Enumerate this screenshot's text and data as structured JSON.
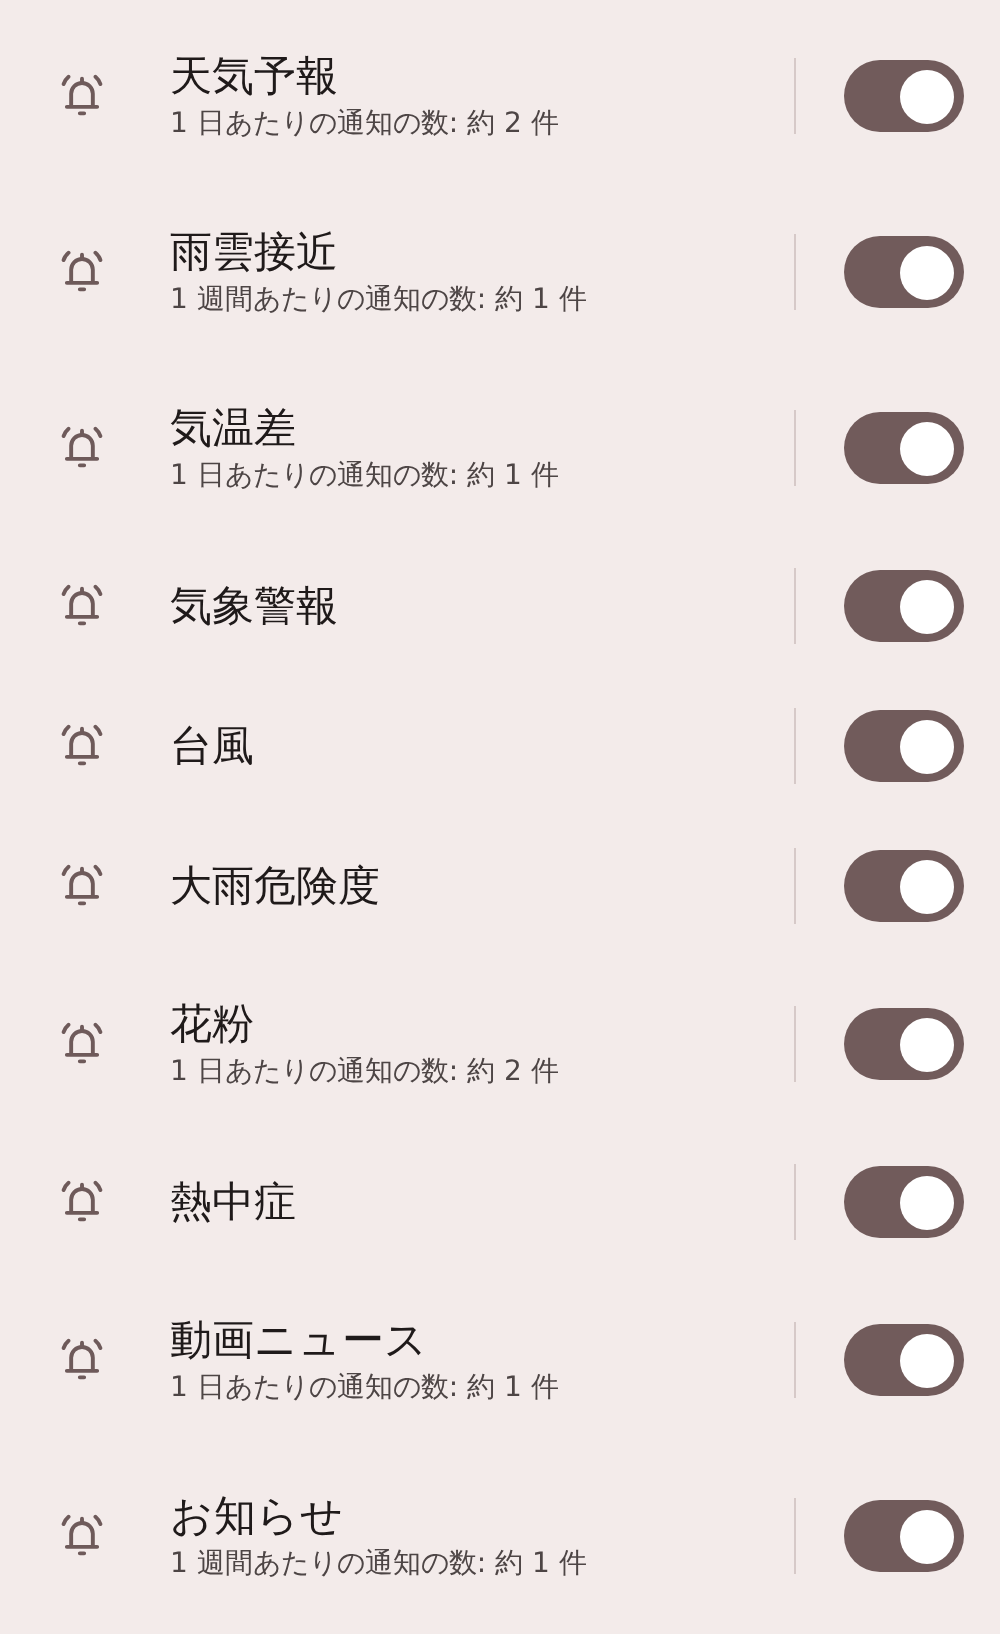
{
  "items": [
    {
      "title": "天気予報",
      "subtitle": "1 日あたりの通知の数: 約 2 件",
      "on": true
    },
    {
      "title": "雨雲接近",
      "subtitle": "1 週間あたりの通知の数: 約 1 件",
      "on": true
    },
    {
      "title": "気温差",
      "subtitle": "1 日あたりの通知の数: 約 1 件",
      "on": true
    },
    {
      "title": "気象警報",
      "on": true
    },
    {
      "title": "台風",
      "on": true
    },
    {
      "title": "大雨危険度",
      "on": true
    },
    {
      "title": "花粉",
      "subtitle": "1 日あたりの通知の数: 約 2 件",
      "on": true
    },
    {
      "title": "熱中症",
      "on": true
    },
    {
      "title": "動画ニュース",
      "subtitle": "1 日あたりの通知の数: 約 1 件",
      "on": true
    },
    {
      "title": "お知らせ",
      "subtitle": "1 週間あたりの通知の数: 約 1 件",
      "on": true
    }
  ]
}
